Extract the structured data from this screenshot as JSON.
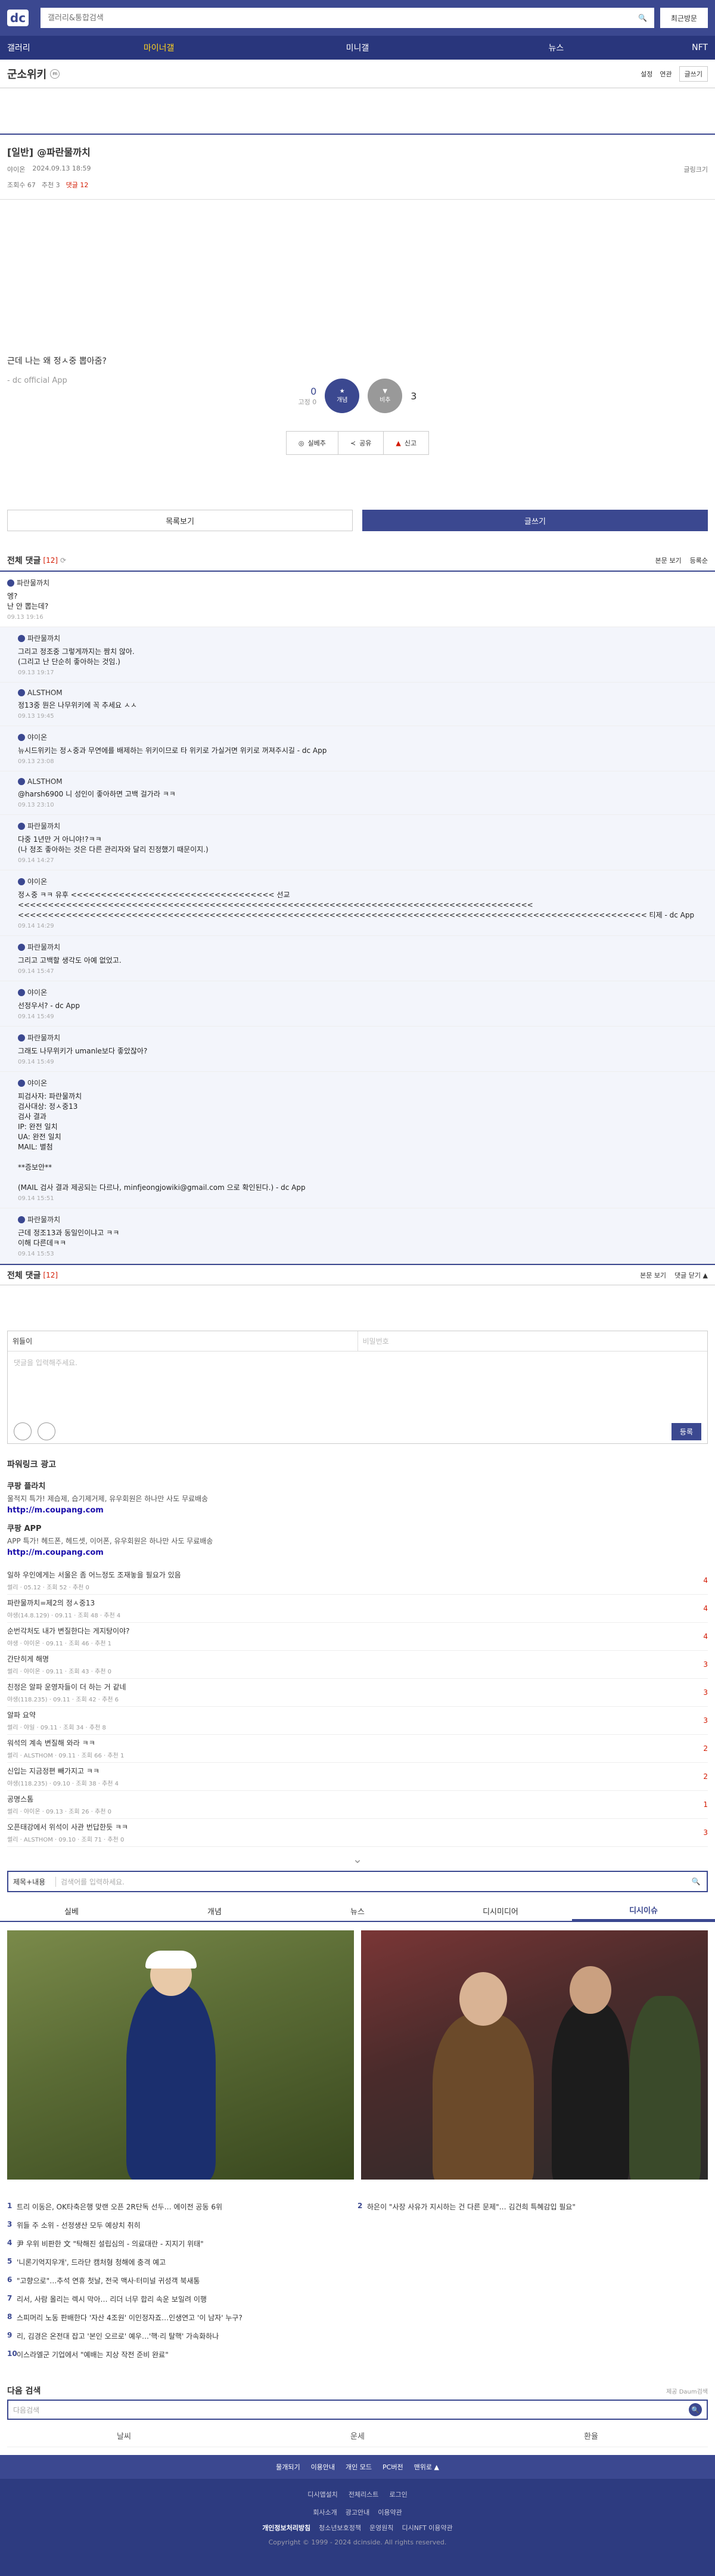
{
  "header": {
    "logo": "dc",
    "search_placeholder": "갤러리&통합검색",
    "recent": "최근방문"
  },
  "gnb": [
    "갤러리",
    "마이너갤",
    "미니갤",
    "뉴스",
    "NFT"
  ],
  "gallery": {
    "name": "군소위키",
    "setting": "설정",
    "recommend": "연관",
    "write": "글쓰기"
  },
  "post": {
    "category": "[일반]",
    "title": "@파란물까치",
    "author": "야이온",
    "date": "2024.09.13 18:59",
    "share": "글링크기",
    "views": "조회수 67",
    "recs": "추천 3",
    "cmts": "댓글 12",
    "body": "근데 나는 왜 정ㅅ중 뽑아줌?",
    "app": "- dc official App"
  },
  "rec": {
    "up": "0",
    "up_fixed": "고정 0",
    "up_label": "개념",
    "dn": "3",
    "dn_label": "비추",
    "share": "공유",
    "report": "신고",
    "dc": "실베추"
  },
  "buttons": {
    "list": "목록보기",
    "write": "글쓰기"
  },
  "comments": {
    "title": "전체 댓글",
    "count": "[12]",
    "opt1": "본문 보기",
    "opt2": "등록순",
    "items": [
      {
        "nick": "파란물까치",
        "text": "엥?\n난 안 뽑는데?",
        "date": "09.13 19:16",
        "reply": false
      },
      {
        "nick": "파란물까치",
        "text": "그리고 정조중 그렇게까지는 짬치 않아.\n(그리고 난 단순히 좋아하는 것임.)",
        "date": "09.13 19:17",
        "reply": true
      },
      {
        "nick": "ALSTHOM",
        "text": "정13중 뭔은 나무위키에 꼭 추세요 ㅅㅅ",
        "date": "09.13 19:45",
        "reply": true
      },
      {
        "nick": "야이온",
        "text": "뉴시드위키는 정ㅅ중과 무연에를 배제하는 위키이므로 타 위키로 가실거면 위키로 꺼져주시길 - dc App",
        "date": "09.13 23:08",
        "reply": true
      },
      {
        "nick": "ALSTHOM",
        "text": "@harsh6900 니 성인이 좋아하면 고백 걸가라 ㅋㅋ",
        "date": "09.13 23:10",
        "reply": true
      },
      {
        "nick": "파란물까치",
        "text": "다중 1년만 거 아니야!?ㅋㅋ\n(나 정조 좋아하는 것은 다른 관리자와 달리 진정했기 때문이지.)",
        "date": "09.14 14:27",
        "reply": true
      },
      {
        "nick": "야이온",
        "text": "정ㅅ중 ㅋㅋ 유후 <<<<<<<<<<<<<<<<<<<<<<<<<<<<<<<<<< 선교 <<<<<<<<<<<<<<<<<<<<<<<<<<<<<<<<<<<<<<<<<<<<<<<<<<<<<<<<<<<<<<<<<<<<<<<<<<<<<<<<<<<<<<\n<<<<<<<<<<<<<<<<<<<<<<<<<<<<<<<<<<<<<<<<<<<<<<<<<<<<<<<<<<<<<<<<<<<<<<<<<<<<<<<<<<<<<<<<<<<<<<<<<<<<<<<<< 티제 - dc App",
        "date": "09.14 14:29",
        "reply": true
      },
      {
        "nick": "파란물까치",
        "text": "그리고 고백할 생각도 아예 없었고.",
        "date": "09.14 15:47",
        "reply": true
      },
      {
        "nick": "야이온",
        "text": "선정우서? - dc App",
        "date": "09.14 15:49",
        "reply": true
      },
      {
        "nick": "파란물까치",
        "text": "그래도 나무위키가 umanle보다 좋았잖아?",
        "date": "09.14 15:49",
        "reply": true
      },
      {
        "nick": "야이온",
        "text": "피검사자: 파란물까치\n검사대상: 정ㅅ중13\n검사 결과\nIP: 완전 일치\nUA: 완전 일치\nMAIL: 별첨\n\n**증보안**\n\n(MAIL 검사 결과 제공되는 다르나, minfjeongjowiki@gmail.com 으로 확인된다.) - dc App",
        "date": "09.14 15:51",
        "reply": true
      },
      {
        "nick": "파란물까치",
        "text": "근데 정조13과 동일인이냐고 ㅋㅋ\n이해 다른데ㅋㅋ",
        "date": "09.14 15:53",
        "reply": true
      }
    ]
  },
  "writer": {
    "nick": "위들이",
    "pw": "비밀번호",
    "placeholder": "댓글을 입력해주세요.",
    "submit": "등록"
  },
  "powerlink": {
    "title": "파워링크 광고",
    "items": [
      {
        "title": "쿠팡 플라치",
        "desc": "울적지 특가! 제습제, 습기제거제, 유우회원은 하나만 사도 무료배송",
        "url": "http://m.coupang.com"
      },
      {
        "title": "쿠팡 APP",
        "desc": "APP 특가! 헤드폰, 헤드셋, 이어폰, 유우회원은 하나만 사도 무료배송",
        "url": "http://m.coupang.com"
      }
    ]
  },
  "related": [
    {
      "t": "일하 우인에게는 서울은 좀 어느정도 조재놓을 필요가 있음",
      "m": "썰리 · 05.12 · 조회 52 · 추천 0",
      "c": "4"
    },
    {
      "t": "파란물까치=제2의 정ㅅ중13",
      "m": "야생(14.8.129) · 09.11 · 조회 48 · 추천 4",
      "c": "4"
    },
    {
      "t": "순번각처도 내가 변질한다는 게지탕이야?",
      "m": "야생 · 야이온 · 09.11 · 조회 46 · 추천 1",
      "c": "4"
    },
    {
      "t": "간단히게 해명",
      "m": "썰리 · 야이온 · 09.11 · 조회 43 · 추천 0",
      "c": "3"
    },
    {
      "t": "친정은 알파 운영자들이 더 하는 거 같네",
      "m": "야생(118.235) · 09.11 · 조회 42 · 추천 6",
      "c": "3"
    },
    {
      "t": "알파 요약",
      "m": "썰리 · 야일 · 09.11 · 조회 34 · 추천 8",
      "c": "3"
    },
    {
      "t": "워석의 계속 변질해 와라 ㅋㅋ",
      "m": "썰리 · ALSTHOM · 09.11 · 조회 66 · 추천 1",
      "c": "2"
    },
    {
      "t": "신입는 지금정편 빼가지고 ㅋㅋ",
      "m": "야생(118.235) · 09.10 · 조회 38 · 추천 4",
      "c": "2"
    },
    {
      "t": "공명스톰",
      "m": "썰리 · 야이온 · 09.13 · 조회 26 · 추천 0",
      "c": "1"
    },
    {
      "t": "오픈태강에서 위석이 사관 번답한듯 ㅋㅋ",
      "m": "썰리 · ALSTHOM · 09.10 · 조회 71 · 추천 0",
      "c": "3"
    }
  ],
  "gsearch": {
    "sel": "제목+내용",
    "placeholder": "검색어를 입력하세요."
  },
  "tabs": [
    "실베",
    "개념",
    "뉴스",
    "디시미디어",
    "디시이슈"
  ],
  "news": [
    [
      "1",
      "트리 이동은, OK타축은행 맞랜 오픈 2R단독 선두… 에이전 공동 6위",
      "2",
      "하은이 \"사장 사유가 지시하는 건 다른 문제\"… 김건희 특혜감입 필요\""
    ],
    [
      "3",
      "위들 주 소위 - 선정생산 모두 예상치 취히",
      "",
      ""
    ],
    [
      "4",
      "尹 우위 비판한 文 \"탁해진 설립심의 - 의료대란 - 지지기 위태\"",
      "",
      ""
    ],
    [
      "5",
      "'니론기억지우개', 드라단 캠처형 청해에 충격 예고",
      "",
      ""
    ],
    [
      "6",
      "\"고향으로\"…추석 연휴 첫날, 전국 맥사·터미널 귀성객 북새통",
      "",
      ""
    ],
    [
      "7",
      "리서, 사람 올리는 렉시 막아… 리더 너무 합리 속운 보일려 이행",
      "",
      ""
    ],
    [
      "8",
      "스피머리 노동 판배한다 '자산 4조원' 이인정자죠…인생연고 '이 남자' 누구?",
      "",
      ""
    ],
    [
      "9",
      "리, 김경은 온전대 잡고 '본인 오르로' 예우…'핵·리 탈핵' 가속화하나",
      "",
      ""
    ],
    [
      "10",
      "이스라엘군 기업에서 \"예배는 지상 작전 준비 완료\"",
      "",
      ""
    ]
  ],
  "dsearch": {
    "title": "다음 검색",
    "right": "제공 Daum검색",
    "placeholder": "다음검색",
    "tabs": [
      "날씨",
      "운세",
      "환율"
    ]
  },
  "footer": {
    "row1": [
      "물개되기",
      "이용안내",
      "개인 모드",
      "PC버전",
      "맨위로 ▲"
    ],
    "row2": [
      "디시앱설치",
      "전체리스트",
      "로그인"
    ],
    "row3": [
      "회사소개",
      "광고안내",
      "이용약관"
    ],
    "row4": [
      "개인정보처리방침",
      "청소년보호정책",
      "운영원칙",
      "디시NFT 이용약관"
    ],
    "copy": "Copyright © 1999 - 2024 dcinside. All rights reserved."
  }
}
